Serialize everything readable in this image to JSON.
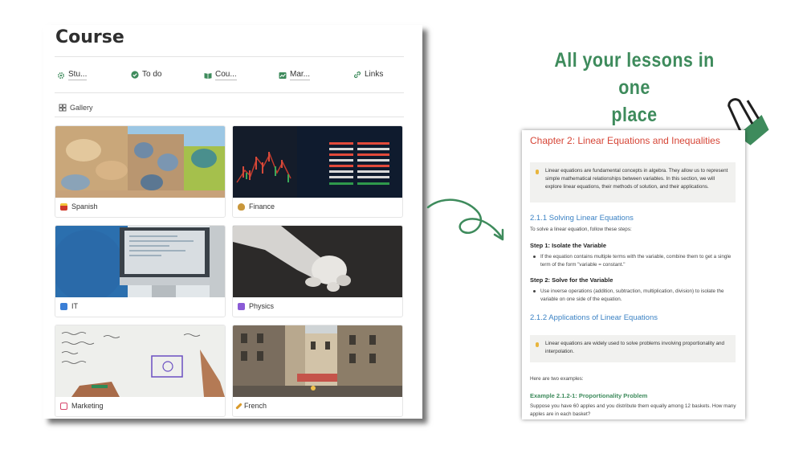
{
  "left_panel": {
    "title": "Course",
    "nav_links": [
      {
        "label": "Stu...",
        "icon": "gear-icon"
      },
      {
        "label": "To do",
        "icon": "check-circle-icon"
      },
      {
        "label": "Cou...",
        "icon": "book-icon"
      },
      {
        "label": "Mar...",
        "icon": "chart-icon"
      },
      {
        "label": "Links",
        "icon": "link-icon"
      }
    ],
    "view_tab": {
      "label": "Gallery",
      "icon": "gallery-grid-icon"
    },
    "cards": [
      {
        "label": "Spanish",
        "image": "architecture-photo",
        "emoji_color": "#d0392b"
      },
      {
        "label": "Finance",
        "image": "stock-chart-photo",
        "emoji_color": "#c9973b"
      },
      {
        "label": "IT",
        "image": "computer-photo",
        "emoji_color": "#3b7fd6"
      },
      {
        "label": "Physics",
        "image": "robot-hand-photo",
        "emoji_color": "#8a5bd6"
      },
      {
        "label": "Marketing",
        "image": "whiteboard-photo",
        "emoji_color": "#d6456b"
      },
      {
        "label": "French",
        "image": "paris-street-photo",
        "emoji_color": "#d99a2a"
      }
    ]
  },
  "headline": {
    "line1": "All your lessons in one",
    "line2": "place"
  },
  "document": {
    "title": "Chapter 2: Linear Equations and Inequalities",
    "callout1": "Linear equations are fundamental concepts in algebra. They allow us to represent simple mathematical relationships between variables. In this section, we will explore linear equations, their methods of solution, and their applications.",
    "section1_heading": "2.1.1 Solving Linear Equations",
    "section1_intro": "To solve a linear equation, follow these steps:",
    "step1_heading": "Step 1: Isolate the Variable",
    "step1_text": "If the equation contains multiple terms with the variable, combine them to get a single term of the form \"variable = constant.\"",
    "step2_heading": "Step 2: Solve for the Variable",
    "step2_text": "Use inverse operations (addition, subtraction, multiplication, division) to isolate the variable on one side of the equation.",
    "section2_heading": "2.1.2 Applications of Linear Equations",
    "callout2": "Linear equations are widely used to solve problems involving proportionality and interpolation.",
    "examples_intro": "Here are two examples:",
    "example_heading": "Example 2.1.2-1: Proportionality Problem",
    "example_text": "Suppose you have 60 apples and you distribute them equally among 12 baskets. How many apples are in each basket?"
  },
  "colors": {
    "accent_green": "#3e8b5c",
    "doc_title_red": "#d64536",
    "doc_heading_blue": "#3b82c4"
  }
}
